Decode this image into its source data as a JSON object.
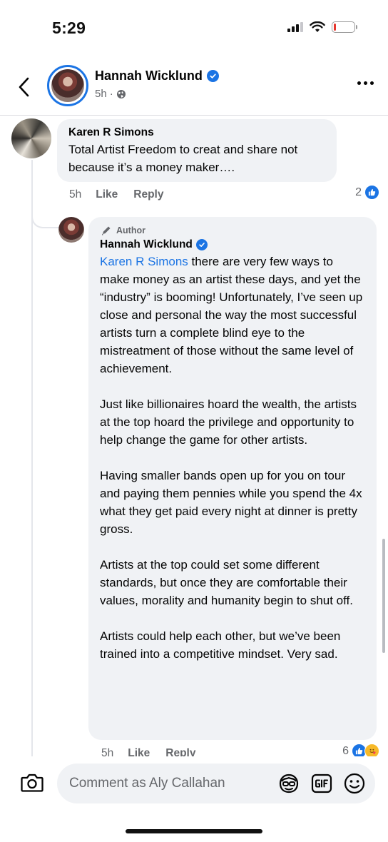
{
  "status_bar": {
    "time": "5:29",
    "battery_color": "#e5352c",
    "battery_level": 0.1
  },
  "header": {
    "page_name": "Hannah Wicklund",
    "verified": true,
    "meta_time": "5h",
    "meta_separator": "·",
    "audience_icon": "globe-icon",
    "accent_color": "#1b74e4"
  },
  "comments": [
    {
      "author": "Karen R Simons",
      "text": "Total Artist Freedom to creat and share not because it’s a money maker….",
      "time": "5h",
      "like_label": "Like",
      "reply_label": "Reply",
      "reaction_count": "2"
    }
  ],
  "reply": {
    "badge": "Author",
    "author": "Hannah Wicklund",
    "mention": "Karen R Simons",
    "paragraphs": [
      " there are very few ways to make money as an artist these days, and yet the “industry” is booming! Unfortunately, I’ve seen up close and personal the way the most successful artists turn a complete blind eye to the mistreatment of those without the same level of achievement.",
      "Just like billionaires hoard the wealth, the artists at the top hoard the privilege and opportunity to help change the game for other artists.",
      "Having smaller bands open up for you on tour and paying them pennies while you spend the 4x what they get paid every night at dinner is pretty gross.",
      "Artists at the top could set some different standards, but once they are comfortable their values, morality and humanity begin to shut off.",
      "Artists could help each other, but we’ve been trained into a competitive mindset. Very sad."
    ],
    "time": "5h",
    "like_label": "Like",
    "reply_label": "Reply",
    "reaction_count": "6"
  },
  "composer": {
    "placeholder": "Comment as Aly Callahan",
    "icons": [
      "camera-icon",
      "avatar-sticker-icon",
      "gif-icon",
      "emoji-icon"
    ]
  }
}
